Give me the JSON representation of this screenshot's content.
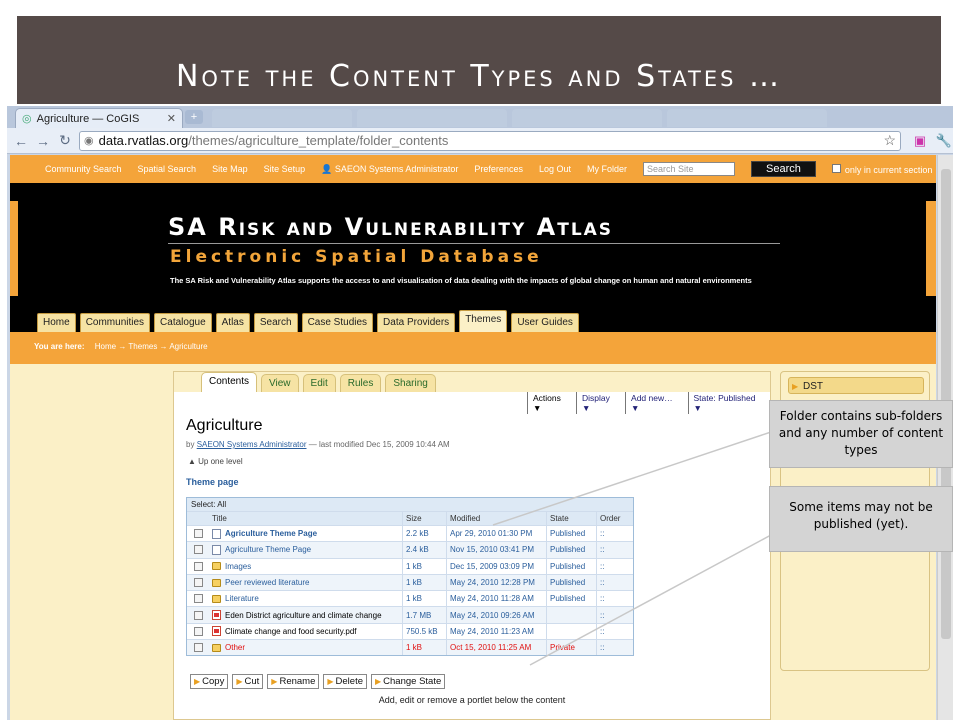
{
  "slide_title": "Note the Content Types and States …",
  "browser": {
    "tab_title": "Agriculture — CoGIS",
    "url_domain": "data.rvatlas.org",
    "url_path": "/themes/agriculture_template/folder_contents"
  },
  "site_top": {
    "links": [
      "Community Search",
      "Spatial Search",
      "Site Map",
      "Site Setup",
      "SAEON Systems Administrator",
      "Preferences",
      "Log Out",
      "My Folder"
    ],
    "search_placeholder": "Search Site",
    "search_button": "Search",
    "only_section": "only in current section"
  },
  "header": {
    "title": "SA Risk and Vulnerability Atlas",
    "subtitle": "Electronic Spatial Database",
    "tagline": "The SA Risk and Vulnerability Atlas supports the access to and visualisation of data dealing with the impacts of global change on human and natural environments"
  },
  "site_tabs": [
    "Home",
    "Communities",
    "Catalogue",
    "Atlas",
    "Search",
    "Case Studies",
    "Data Providers",
    "Themes",
    "User Guides"
  ],
  "breadcrumb": {
    "label": "You are here:",
    "path": "Home → Themes → Agriculture"
  },
  "content_tabs": [
    "Contents",
    "View",
    "Edit",
    "Rules",
    "Sharing"
  ],
  "actions": [
    "Actions ▼",
    "Display ▼",
    "Add new… ▼",
    "State: Published ▼"
  ],
  "page": {
    "title": "Agriculture",
    "by": "by",
    "author": "SAEON Systems Administrator",
    "modified": "— last modified Dec 15, 2009 10:44 AM",
    "up_level": "Up one level",
    "theme_page": "Theme page"
  },
  "table": {
    "select_label": "Select:",
    "select_all": "All",
    "headers": [
      "Title",
      "Size",
      "Modified",
      "State",
      "Order"
    ],
    "rows": [
      {
        "title": "Agriculture Theme Page",
        "size": "2.2 kB",
        "modified": "Apr 29, 2010 01:30 PM",
        "state": "Published",
        "order": "::",
        "icon": "document-icon"
      },
      {
        "title": "Agriculture Theme Page",
        "size": "2.4 kB",
        "modified": "Nov 15, 2010 03:41 PM",
        "state": "Published",
        "order": "::",
        "icon": "document-icon"
      },
      {
        "title": "Images",
        "size": "1 kB",
        "modified": "Dec 15, 2009 03:09 PM",
        "state": "Published",
        "order": "::",
        "icon": "folder-icon"
      },
      {
        "title": "Peer reviewed literature",
        "size": "1 kB",
        "modified": "May 24, 2010 12:28 PM",
        "state": "Published",
        "order": "::",
        "icon": "folder-icon"
      },
      {
        "title": "Literature",
        "size": "1 kB",
        "modified": "May 24, 2010 11:28 AM",
        "state": "Published",
        "order": "::",
        "icon": "folder-icon"
      },
      {
        "title": "Eden District agriculture and climate change",
        "size": "1.7 MB",
        "modified": "May 24, 2010 09:26 AM",
        "state": "",
        "order": "::",
        "icon": "pdf-icon"
      },
      {
        "title": "Climate change and food security.pdf",
        "size": "750.5 kB",
        "modified": "May 24, 2010 11:23 AM",
        "state": "",
        "order": "::",
        "icon": "pdf-icon"
      },
      {
        "title": "Other",
        "size": "1 kB",
        "modified": "Oct 15, 2010 11:25 AM",
        "state": "Private",
        "order": "::",
        "icon": "folder-icon"
      }
    ]
  },
  "buttons": [
    "Copy",
    "Cut",
    "Rename",
    "Delete",
    "Change State"
  ],
  "portlet_text": "Add, edit or remove a portlet below the content",
  "right_portlet": "DST",
  "callouts": [
    "Folder contains sub-folders and any number of content types",
    "Some items may not be published (yet)."
  ],
  "colors": {
    "banner": "#554a48",
    "site_orange": "#f4a43a",
    "page_cream": "#fbf0c7",
    "link_blue": "#2a5e9c",
    "private_red": "#e01010"
  }
}
